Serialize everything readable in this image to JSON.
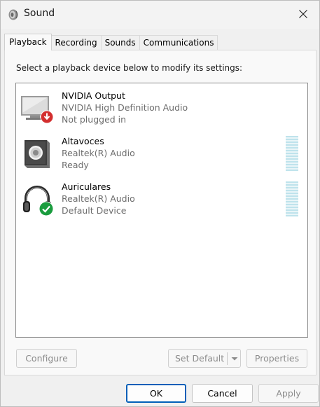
{
  "window": {
    "title": "Sound",
    "icon": "speaker-icon",
    "close_icon": "close-icon"
  },
  "tabs": [
    {
      "label": "Playback",
      "active": true
    },
    {
      "label": "Recording",
      "active": false
    },
    {
      "label": "Sounds",
      "active": false
    },
    {
      "label": "Communications",
      "active": false
    }
  ],
  "playback": {
    "instruction": "Select a playback device below to modify its settings:",
    "devices": [
      {
        "name": "NVIDIA Output",
        "driver": "NVIDIA High Definition Audio",
        "status": "Not plugged in",
        "icon": "monitor-icon",
        "badge": "unplugged-badge-icon",
        "meter": false
      },
      {
        "name": "Altavoces",
        "driver": "Realtek(R) Audio",
        "status": "Ready",
        "icon": "speaker-box-icon",
        "meter": true
      },
      {
        "name": "Auriculares",
        "driver": "Realtek(R) Audio",
        "status": "Default Device",
        "icon": "headphones-icon",
        "badge": "default-check-icon",
        "meter": true
      }
    ],
    "buttons": {
      "configure": "Configure",
      "set_default": "Set Default",
      "properties": "Properties"
    }
  },
  "footer": {
    "ok": "OK",
    "cancel": "Cancel",
    "apply": "Apply"
  },
  "colors": {
    "accent": "#005fb8",
    "default_badge": "#1a9c3e",
    "unplugged_badge": "#d32f2f"
  }
}
